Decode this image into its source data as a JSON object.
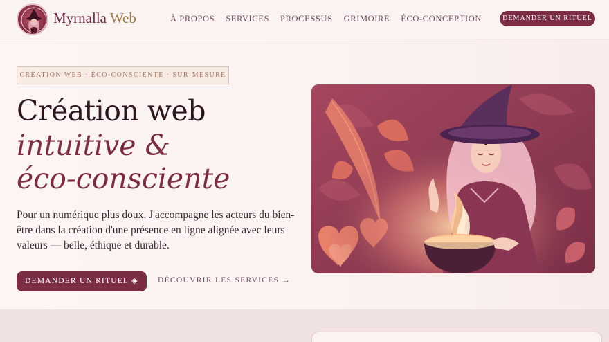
{
  "brand": {
    "name": "Myrnalla",
    "suffix": "Web"
  },
  "nav": {
    "items": [
      "À PROPOS",
      "SERVICES",
      "PROCESSUS",
      "GRIMOIRE",
      "ÉCO-CONCEPTION"
    ],
    "cta": "DEMANDER UN RITUEL"
  },
  "hero": {
    "tagline": "CRÉATION WEB · ÉCO-CONSCIENTE · SUR-MESURE",
    "title_line1": "Création web",
    "title_line2": "intuitive &",
    "title_line3": "éco-consciente",
    "lead": "Pour un numérique plus doux. J'accompagne les acteurs du bien-être dans la création d'une présence en ligne alignée avec leurs valeurs — belle, éthique et durable.",
    "primary_button": "DEMANDER UN RITUEL ◈",
    "secondary_link": "DÉCOUVRIR LES SERVICES →"
  },
  "colors": {
    "accent": "#7b2d44",
    "background": "#fbf3f1",
    "gold": "#9b7a4a"
  }
}
